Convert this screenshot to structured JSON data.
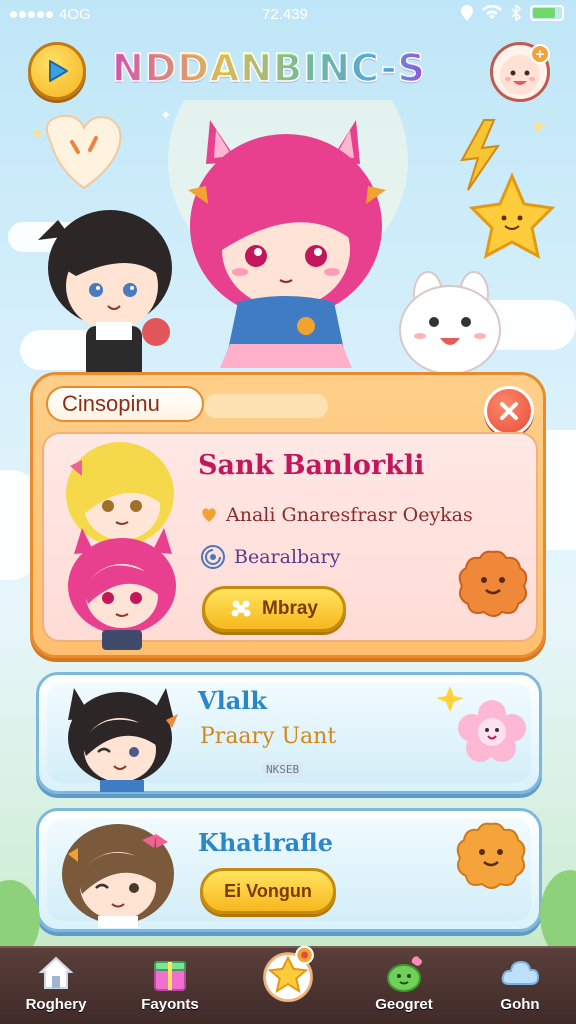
{
  "status_bar": {
    "carrier": "4OG",
    "time": "72.439"
  },
  "header": {
    "title": "NDDANBINC-S",
    "play_icon": "play-icon",
    "profile_icon": "avatar-icon",
    "profile_badge_symbol": "+"
  },
  "main_card": {
    "tab_label": "Cinsopinu",
    "close_icon": "close-icon",
    "character_name": "Sank Banlorkli",
    "detail_line": "Anali Gnaresfrasr Oeykas",
    "tag_line": "Bearalbary",
    "action_button": "Mbray"
  },
  "cards": [
    {
      "title": "Vlalk",
      "subtitle": "Praary Uant",
      "small_tag": "NKSEB"
    },
    {
      "title": "Khatlrafle",
      "button": "Ei Vongun"
    }
  ],
  "bottom_nav": [
    {
      "label": "Roghery",
      "icon": "home-icon"
    },
    {
      "label": "Fayonts",
      "icon": "gift-icon"
    },
    {
      "label": "",
      "icon": "star-mascot-icon"
    },
    {
      "label": "Geogret",
      "icon": "slime-icon"
    },
    {
      "label": "Gohn",
      "icon": "cloud-icon"
    }
  ],
  "colors": {
    "accent_orange": "#e98a2c",
    "accent_pink": "#c2185b",
    "accent_blue": "#2a87c8",
    "button_yellow": "#f6b81f",
    "nav_bg": "#3f2b28"
  }
}
